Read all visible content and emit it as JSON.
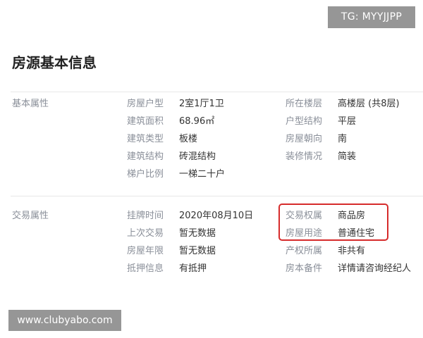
{
  "watermarks": {
    "top": "TG: MYYJJPP",
    "bottom": "www.clubyabo.com"
  },
  "title": "房源基本信息",
  "basic": {
    "label": "基本属性",
    "left": [
      {
        "k": "房屋户型",
        "v": "2室1厅1卫"
      },
      {
        "k": "建筑面积",
        "v": "68.96㎡"
      },
      {
        "k": "建筑类型",
        "v": "板楼"
      },
      {
        "k": "建筑结构",
        "v": "砖混结构"
      },
      {
        "k": "梯户比例",
        "v": "一梯二十户"
      }
    ],
    "right": [
      {
        "k": "所在楼层",
        "v": "高楼层 (共8层)"
      },
      {
        "k": "户型结构",
        "v": "平层"
      },
      {
        "k": "房屋朝向",
        "v": "南"
      },
      {
        "k": "装修情况",
        "v": "简装"
      }
    ]
  },
  "transaction": {
    "label": "交易属性",
    "left": [
      {
        "k": "挂牌时间",
        "v": "2020年08月10日"
      },
      {
        "k": "上次交易",
        "v": "暂无数据"
      },
      {
        "k": "房屋年限",
        "v": "暂无数据"
      },
      {
        "k": "抵押信息",
        "v": "有抵押"
      }
    ],
    "right": [
      {
        "k": "交易权属",
        "v": "商品房"
      },
      {
        "k": "房屋用途",
        "v": "普通住宅"
      },
      {
        "k": "产权所属",
        "v": "非共有"
      },
      {
        "k": "房本备件",
        "v": "详情请咨询经纪人"
      }
    ]
  },
  "colors": {
    "highlight": "#d62b2b",
    "key_text": "#8a8f99",
    "value_text": "#333333"
  }
}
